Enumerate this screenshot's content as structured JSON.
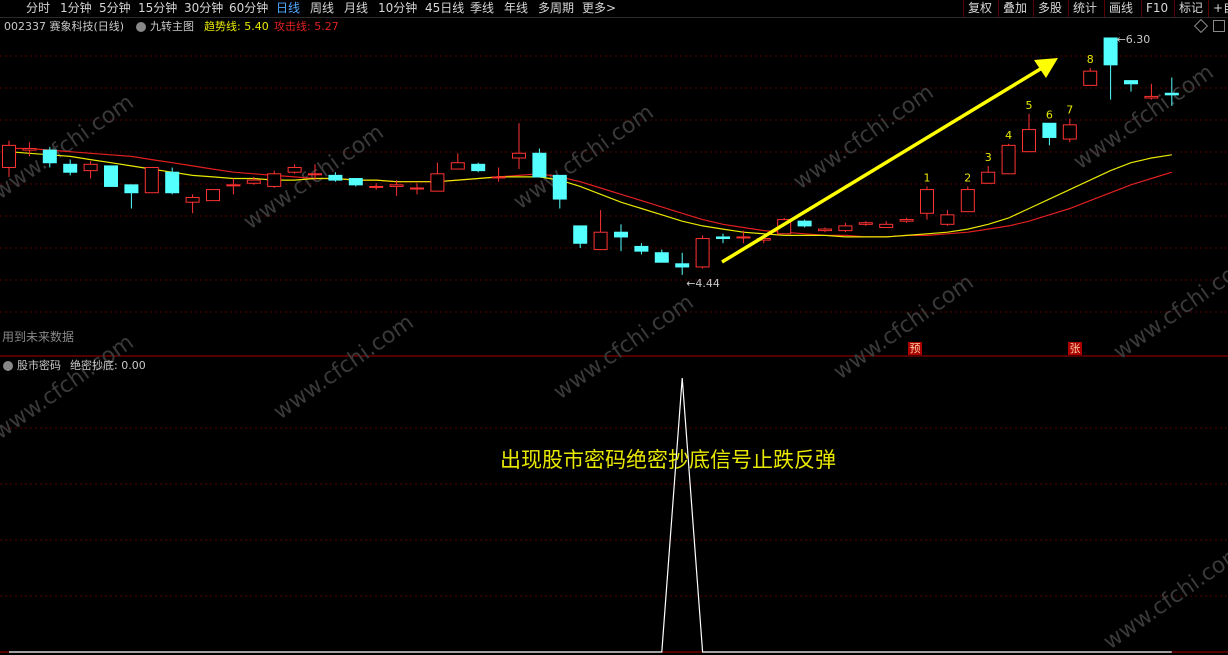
{
  "toolbar": {
    "periods": [
      "分时",
      "1分钟",
      "5分钟",
      "15分钟",
      "30分钟",
      "60分钟",
      "日线",
      "周线",
      "月线",
      "10分钟",
      "45日线",
      "季线",
      "年线",
      "多周期",
      "更多>"
    ],
    "active_period": "日线",
    "tools": [
      "复权",
      "叠加",
      "多股",
      "统计",
      "画线",
      "F10",
      "标记"
    ],
    "right_edge": "+自"
  },
  "main_panel": {
    "stock": "002337 赛象科技(日线)",
    "indicator_name": "九转主图",
    "trend_label": "趋势线: 5.40",
    "attack_label": "攻击线: 5.27",
    "bottom_left_text": "用到未来数据",
    "high_label": "6.30",
    "low_label": "4.44",
    "nine_counts": [
      "1",
      "2",
      "3",
      "4",
      "5",
      "6",
      "7",
      "8"
    ],
    "markers": [
      "预",
      "张"
    ],
    "colors": {
      "up": "#ff3232",
      "down": "#54ffff",
      "trend": "#e8e800",
      "attack": "#e02020",
      "arrow": "#ffff00"
    }
  },
  "sub_panel": {
    "indicator": "股市密码",
    "signal_label": "绝密抄底: 0.00",
    "annotation": "出现股市密码绝密抄底信号止跌反弹"
  },
  "watermark": "www.cfchi.com",
  "chart_data": {
    "type": "candlestick",
    "candles": [
      {
        "o": 5.48,
        "c": 5.62,
        "h": 5.65,
        "l": 5.42
      },
      {
        "o": 5.59,
        "c": 5.6,
        "h": 5.64,
        "l": 5.55
      },
      {
        "o": 5.59,
        "c": 5.51,
        "h": 5.61,
        "l": 5.48
      },
      {
        "o": 5.5,
        "c": 5.45,
        "h": 5.53,
        "l": 5.43
      },
      {
        "o": 5.46,
        "c": 5.5,
        "h": 5.52,
        "l": 5.41
      },
      {
        "o": 5.49,
        "c": 5.36,
        "h": 5.49,
        "l": 5.36
      },
      {
        "o": 5.37,
        "c": 5.32,
        "h": 5.37,
        "l": 5.22
      },
      {
        "o": 5.32,
        "c": 5.48,
        "h": 5.48,
        "l": 5.32
      },
      {
        "o": 5.45,
        "c": 5.32,
        "h": 5.48,
        "l": 5.31
      },
      {
        "o": 5.26,
        "c": 5.29,
        "h": 5.31,
        "l": 5.19
      },
      {
        "o": 5.27,
        "c": 5.34,
        "h": 5.34,
        "l": 5.27
      },
      {
        "o": 5.37,
        "c": 5.37,
        "h": 5.41,
        "l": 5.31
      },
      {
        "o": 5.38,
        "c": 5.4,
        "h": 5.42,
        "l": 5.37
      },
      {
        "o": 5.36,
        "c": 5.44,
        "h": 5.46,
        "l": 5.35
      },
      {
        "o": 5.45,
        "c": 5.48,
        "h": 5.5,
        "l": 5.44
      },
      {
        "o": 5.44,
        "c": 5.44,
        "h": 5.5,
        "l": 5.4
      },
      {
        "o": 5.43,
        "c": 5.4,
        "h": 5.45,
        "l": 5.39
      },
      {
        "o": 5.41,
        "c": 5.37,
        "h": 5.41,
        "l": 5.36
      },
      {
        "o": 5.36,
        "c": 5.36,
        "h": 5.38,
        "l": 5.34
      },
      {
        "o": 5.36,
        "c": 5.37,
        "h": 5.4,
        "l": 5.3
      },
      {
        "o": 5.35,
        "c": 5.35,
        "h": 5.38,
        "l": 5.31
      },
      {
        "o": 5.33,
        "c": 5.44,
        "h": 5.51,
        "l": 5.33
      },
      {
        "o": 5.47,
        "c": 5.51,
        "h": 5.57,
        "l": 5.47
      },
      {
        "o": 5.5,
        "c": 5.46,
        "h": 5.51,
        "l": 5.45
      },
      {
        "o": 5.42,
        "c": 5.42,
        "h": 5.48,
        "l": 5.39
      },
      {
        "o": 5.54,
        "c": 5.57,
        "h": 5.76,
        "l": 5.47
      },
      {
        "o": 5.57,
        "c": 5.42,
        "h": 5.6,
        "l": 5.42
      },
      {
        "o": 5.43,
        "c": 5.28,
        "h": 5.43,
        "l": 5.22
      },
      {
        "o": 5.11,
        "c": 5.0,
        "h": 5.11,
        "l": 4.97
      },
      {
        "o": 4.96,
        "c": 5.07,
        "h": 5.21,
        "l": 4.96
      },
      {
        "o": 5.07,
        "c": 5.04,
        "h": 5.12,
        "l": 4.95
      },
      {
        "o": 4.98,
        "c": 4.95,
        "h": 5.0,
        "l": 4.93
      },
      {
        "o": 4.94,
        "c": 4.88,
        "h": 4.96,
        "l": 4.88
      },
      {
        "o": 4.87,
        "c": 4.85,
        "h": 4.94,
        "l": 4.8
      },
      {
        "o": 4.85,
        "c": 5.03,
        "h": 5.05,
        "l": 4.84
      },
      {
        "o": 5.04,
        "c": 5.03,
        "h": 5.06,
        "l": 5.0
      },
      {
        "o": 5.04,
        "c": 5.04,
        "h": 5.08,
        "l": 5.0
      },
      {
        "o": 5.02,
        "c": 5.03,
        "h": 5.05,
        "l": 5.0
      },
      {
        "o": 5.06,
        "c": 5.15,
        "h": 5.16,
        "l": 5.06
      },
      {
        "o": 5.14,
        "c": 5.11,
        "h": 5.15,
        "l": 5.1
      },
      {
        "o": 5.08,
        "c": 5.09,
        "h": 5.1,
        "l": 5.07
      },
      {
        "o": 5.08,
        "c": 5.11,
        "h": 5.13,
        "l": 5.07
      },
      {
        "o": 5.12,
        "c": 5.13,
        "h": 5.14,
        "l": 5.11
      },
      {
        "o": 5.1,
        "c": 5.12,
        "h": 5.14,
        "l": 5.1
      },
      {
        "o": 5.14,
        "c": 5.15,
        "h": 5.16,
        "l": 5.13
      },
      {
        "o": 5.19,
        "c": 5.34,
        "h": 5.36,
        "l": 5.15
      },
      {
        "o": 5.12,
        "c": 5.18,
        "h": 5.21,
        "l": 5.11
      },
      {
        "o": 5.2,
        "c": 5.34,
        "h": 5.36,
        "l": 5.2
      },
      {
        "o": 5.38,
        "c": 5.45,
        "h": 5.49,
        "l": 5.38
      },
      {
        "o": 5.44,
        "c": 5.62,
        "h": 5.63,
        "l": 5.44
      },
      {
        "o": 5.58,
        "c": 5.72,
        "h": 5.82,
        "l": 5.58
      },
      {
        "o": 5.76,
        "c": 5.67,
        "h": 5.76,
        "l": 5.62
      },
      {
        "o": 5.66,
        "c": 5.75,
        "h": 5.79,
        "l": 5.64
      },
      {
        "o": 6.0,
        "c": 6.09,
        "h": 6.11,
        "l": 6.0
      },
      {
        "o": 6.3,
        "c": 6.13,
        "h": 6.3,
        "l": 5.91
      },
      {
        "o": 6.03,
        "c": 6.01,
        "h": 6.03,
        "l": 5.96
      },
      {
        "o": 5.92,
        "c": 5.93,
        "h": 6.01,
        "l": 5.91
      },
      {
        "o": 5.95,
        "c": 5.94,
        "h": 6.05,
        "l": 5.87
      }
    ],
    "trend_line": [
      5.58,
      5.57,
      5.56,
      5.55,
      5.53,
      5.51,
      5.49,
      5.47,
      5.45,
      5.43,
      5.42,
      5.41,
      5.41,
      5.4,
      5.4,
      5.41,
      5.41,
      5.4,
      5.4,
      5.39,
      5.39,
      5.39,
      5.4,
      5.41,
      5.42,
      5.42,
      5.42,
      5.4,
      5.36,
      5.31,
      5.26,
      5.22,
      5.18,
      5.14,
      5.11,
      5.09,
      5.07,
      5.06,
      5.05,
      5.05,
      5.05,
      5.04,
      5.04,
      5.04,
      5.05,
      5.06,
      5.07,
      5.09,
      5.12,
      5.16,
      5.22,
      5.28,
      5.34,
      5.4,
      5.46,
      5.51,
      5.54,
      5.56
    ],
    "attack_line": [
      5.6,
      5.6,
      5.59,
      5.58,
      5.57,
      5.56,
      5.55,
      5.53,
      5.51,
      5.49,
      5.47,
      5.45,
      5.44,
      5.43,
      5.42,
      5.41,
      5.41,
      5.4,
      5.4,
      5.39,
      5.39,
      5.39,
      5.4,
      5.41,
      5.42,
      5.43,
      5.44,
      5.42,
      5.39,
      5.35,
      5.31,
      5.27,
      5.23,
      5.19,
      5.15,
      5.12,
      5.1,
      5.08,
      5.07,
      5.06,
      5.05,
      5.05,
      5.04,
      5.04,
      5.05,
      5.05,
      5.06,
      5.07,
      5.09,
      5.11,
      5.14,
      5.18,
      5.22,
      5.27,
      5.32,
      5.37,
      5.41,
      5.45
    ],
    "signal_values": [
      0,
      0,
      0,
      0,
      0,
      0,
      0,
      0,
      0,
      0,
      0,
      0,
      0,
      0,
      0,
      0,
      0,
      0,
      0,
      0,
      0,
      0,
      0,
      0,
      0,
      0,
      0,
      0,
      0,
      0,
      0,
      0,
      0,
      1,
      0,
      0,
      0,
      0,
      0,
      0,
      0,
      0,
      0,
      0,
      0,
      0,
      0,
      0,
      0,
      0,
      0,
      0,
      0,
      0,
      0,
      0,
      0,
      0
    ],
    "ylim": [
      4.4,
      6.3
    ]
  }
}
